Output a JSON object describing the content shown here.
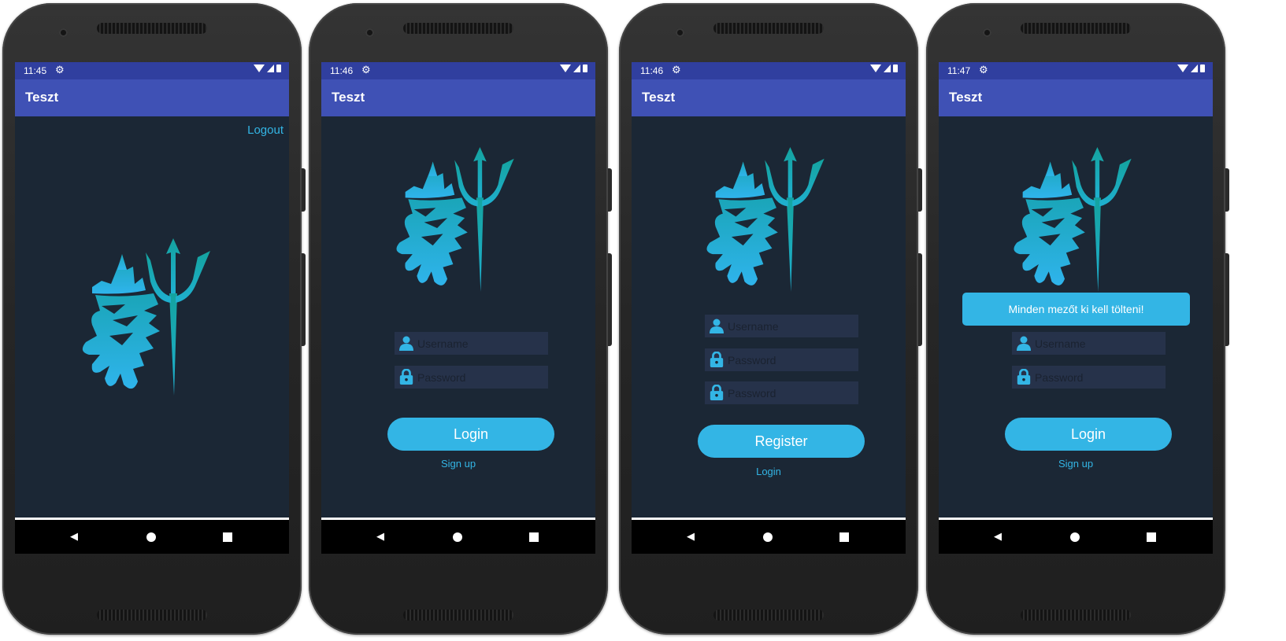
{
  "screens": [
    {
      "time": "11:45",
      "app_title": "Teszt",
      "logout_label": "Logout"
    },
    {
      "time": "11:46",
      "app_title": "Teszt",
      "username_placeholder": "Username",
      "password_placeholder": "Password",
      "login_label": "Login",
      "signup_label": "Sign up"
    },
    {
      "time": "11:46",
      "app_title": "Teszt",
      "username_placeholder": "Username",
      "password_placeholder": "Password",
      "confirm_placeholder": "Password",
      "register_label": "Register",
      "login_link_label": "Login"
    },
    {
      "time": "11:47",
      "app_title": "Teszt",
      "toast_text": "Minden mezőt ki kell tölteni!",
      "username_placeholder": "Username",
      "password_placeholder": "Password",
      "login_label": "Login",
      "signup_label": "Sign up"
    }
  ],
  "colors": {
    "status_bar": "#303f9f",
    "app_bar": "#3f51b5",
    "screen_bg": "#1b2735",
    "accent": "#33b5e5",
    "field_bg": "#26324a",
    "logo_teal": "#16a8a8",
    "logo_blue": "#2ab0e6"
  },
  "icons": {
    "settings": "gear-icon",
    "wifi": "wifi-icon",
    "signal": "signal-icon",
    "battery": "battery-icon",
    "user": "user-icon",
    "lock": "lock-icon",
    "back": "back-icon",
    "home": "home-icon",
    "recents": "recents-icon",
    "logo": "poseidon-trident-logo"
  }
}
